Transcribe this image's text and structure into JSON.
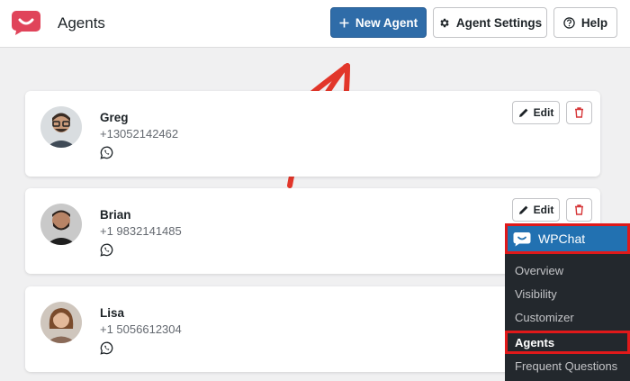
{
  "header": {
    "title": "Agents",
    "new_agent_label": "New Agent",
    "agent_settings_label": "Agent Settings",
    "help_label": "Help"
  },
  "agents": [
    {
      "name": "Greg",
      "phone": "+13052142462"
    },
    {
      "name": "Brian",
      "phone": "+1 9832141485"
    },
    {
      "name": "Lisa",
      "phone": "+1 5056612304"
    }
  ],
  "actions": {
    "edit_label": "Edit"
  },
  "admin_menu": {
    "title": "WPChat",
    "items": [
      "Overview",
      "Visibility",
      "Customizer",
      "Agents",
      "Frequent Questions"
    ],
    "active_item": "Agents"
  },
  "colors": {
    "primary": "#2f6ca8",
    "brand": "#e0445a",
    "delete": "#d63638",
    "highlight": "#e0191a",
    "arrow": "#e2362a"
  }
}
